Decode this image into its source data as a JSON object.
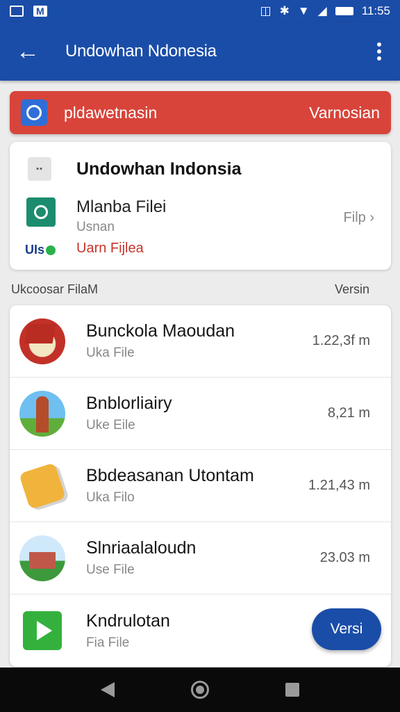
{
  "status_bar": {
    "clock": "11:55"
  },
  "app_bar": {
    "title": "Undowhan Ndonesia",
    "back_icon": "arrow-left-icon",
    "more_icon": "more-vert-icon"
  },
  "banner": {
    "text": "pldawetnasin",
    "action": "Varnosian",
    "color": "#d8443a"
  },
  "info_card": {
    "title": "Undowhan Indonsia",
    "item_title": "Mlanba Filei",
    "item_sub": "Usnan",
    "item_link": "Uarn Fijlea",
    "action": "Filp ›",
    "logo_text": "UIs"
  },
  "section": {
    "title": "Ukcoosar FilaM",
    "right": "Versin"
  },
  "files": [
    {
      "title": "Bunckola Maoudan",
      "sub": "Uka File",
      "size": "1.22,3f m"
    },
    {
      "title": "Bnblorliairy",
      "sub": "Uke Eile",
      "size": "8,21 m"
    },
    {
      "title": "Bbdeasanan Utontam",
      "sub": "Uka Filo",
      "size": "1.21,43 m"
    },
    {
      "title": "Slnriaalaloudn",
      "sub": "Use File",
      "size": "23.03 m"
    },
    {
      "title": "Kndrulotan",
      "sub": "Fia File",
      "size": ""
    }
  ],
  "fab": {
    "label": "Versi"
  },
  "colors": {
    "primary": "#1a4da8",
    "accent_red": "#d8443a"
  }
}
